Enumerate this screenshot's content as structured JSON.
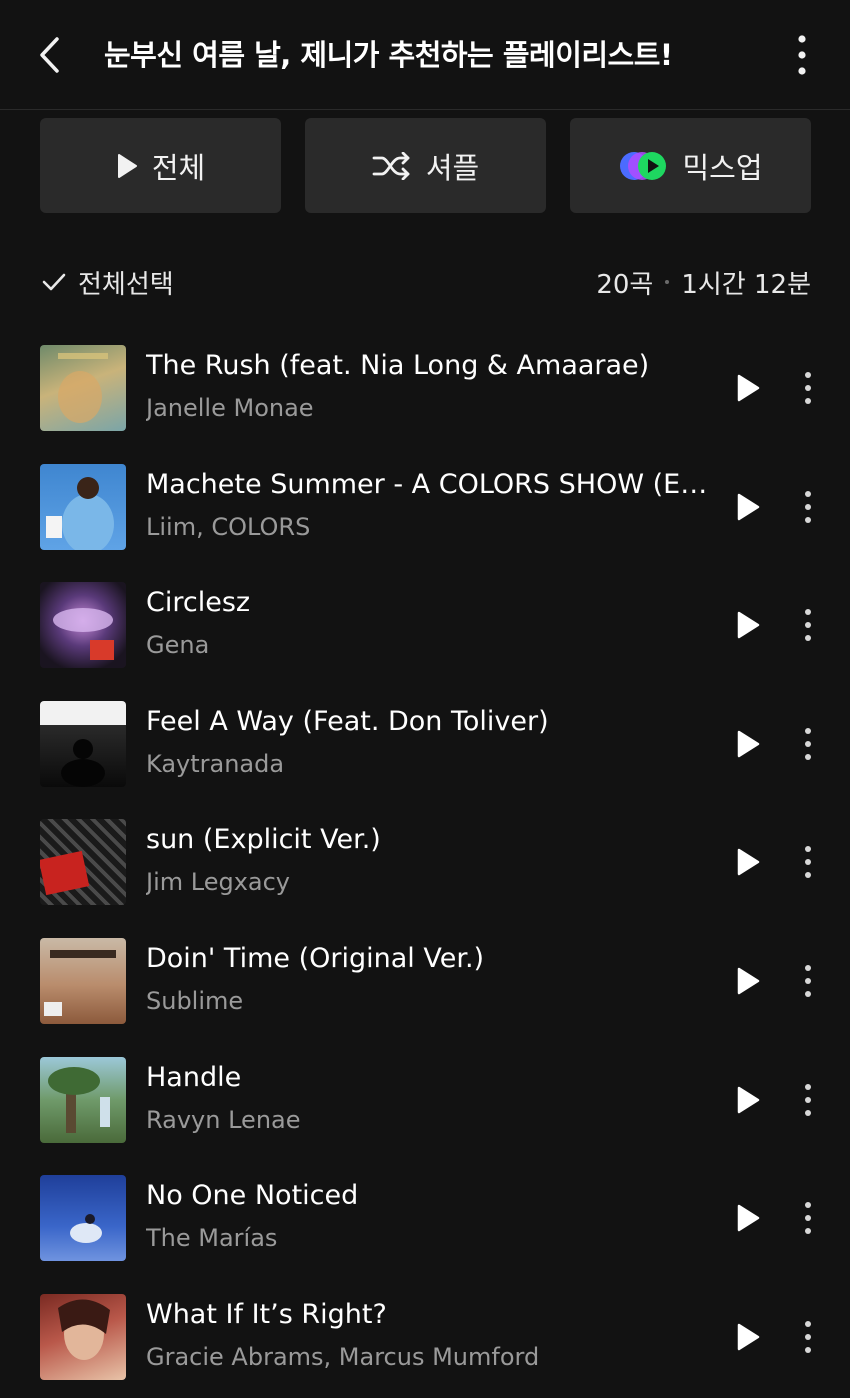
{
  "header": {
    "title": "눈부신 여름 날, 제니가 추천하는 플레이리스트!",
    "back_icon": "chevron-left-icon",
    "menu_icon": "more-vertical-icon"
  },
  "actions": {
    "play_all_label": "전체",
    "shuffle_label": "셔플",
    "mixup_label": "믹스업"
  },
  "list_meta": {
    "select_all_label": "전체선택",
    "track_count": "20곡",
    "duration": "1시간 12분"
  },
  "colors": {
    "background": "#121212",
    "button_bg": "#2a2a2a",
    "accent_green": "#1ed760",
    "accent_blue": "#4b6bff",
    "accent_purple": "#b04bff",
    "secondary_text": "#9a9a9a"
  },
  "tracks": [
    {
      "title": "The Rush (feat. Nia Long & Amaarae)",
      "artist": "Janelle Monae"
    },
    {
      "title": "Machete Summer - A COLORS SHOW (Explicit Ver.)",
      "artist": "Liim, COLORS"
    },
    {
      "title": "Circlesz",
      "artist": "Gena"
    },
    {
      "title": "Feel A Way (Feat. Don Toliver)",
      "artist": "Kaytranada"
    },
    {
      "title": "sun (Explicit Ver.)",
      "artist": "Jim Legxacy"
    },
    {
      "title": "Doin' Time (Original Ver.)",
      "artist": "Sublime"
    },
    {
      "title": "Handle",
      "artist": "Ravyn Lenae"
    },
    {
      "title": "No One Noticed",
      "artist": "The Marías"
    },
    {
      "title": "What If It’s Right?",
      "artist": "Gracie Abrams, Marcus Mumford"
    }
  ]
}
